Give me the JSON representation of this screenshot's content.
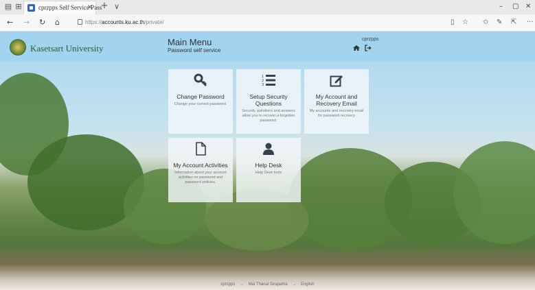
{
  "browser": {
    "tab_title": "cprzpps Self Service Pass",
    "tab_close": "×",
    "new_tab": "+",
    "tab_menu": "∨",
    "window_controls": [
      "–",
      "▢",
      "✕"
    ],
    "url_prefix": "https://",
    "url_host": "accounts.ku.ac.th",
    "url_path": "/private/"
  },
  "header": {
    "university_name": "Kasetsart University",
    "menu_title": "Main Menu",
    "menu_subtitle": "Password self service",
    "username": "cprzpps"
  },
  "tiles": [
    {
      "icon": "key-icon",
      "title": "Change Password",
      "desc": "Change your current password."
    },
    {
      "icon": "list-ordered-icon",
      "title": "Setup Security Questions",
      "desc": "Security questions and answers allow you to recover a forgotten password."
    },
    {
      "icon": "edit-icon",
      "title": "My Account and Recovery Email",
      "desc": "My accounts and recovery email for password recovery"
    },
    {
      "icon": "document-icon",
      "title": "My Account Activities",
      "desc": "Information about your account activities on password and password policies."
    },
    {
      "icon": "user-icon",
      "title": "Help Desk",
      "desc": "Help Desk tools"
    }
  ],
  "footer": {
    "user": "cprzpps",
    "arrow": "→",
    "link1": "Mai Thanai Sirapatha",
    "link2": "English"
  }
}
